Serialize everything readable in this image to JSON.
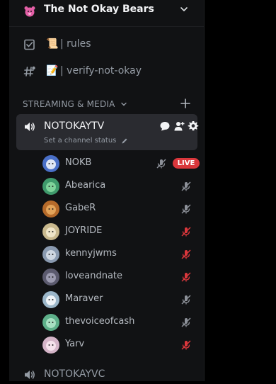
{
  "server": {
    "name": "The Not Okay Bears"
  },
  "text_channels": [
    {
      "emoji": "📜",
      "name": "| rules"
    },
    {
      "emoji": "📝",
      "name": "| verify-not-okay"
    }
  ],
  "category": {
    "label": "STREAMING & MEDIA"
  },
  "active_voice": {
    "name": "NOTOKAYTV",
    "status": "Set a channel status"
  },
  "users": [
    {
      "name": "NOKB",
      "muted": "grey",
      "live": "LIVE",
      "avatar_color": "#4a70c8"
    },
    {
      "name": "Abearica",
      "muted": "grey",
      "avatar_color": "#3f9a6c"
    },
    {
      "name": "GabeR",
      "muted": "grey",
      "avatar_color": "#b56a2a"
    },
    {
      "name": "JOYRIDE",
      "muted": "red",
      "avatar_color": "#c9b98e"
    },
    {
      "name": "kennyjwms",
      "muted": "red",
      "avatar_color": "#8a9ab0"
    },
    {
      "name": "loveandnate",
      "muted": "red",
      "avatar_color": "#5b5a6e"
    },
    {
      "name": "Maraver",
      "muted": "grey",
      "avatar_color": "#9bb6c9"
    },
    {
      "name": "thevoiceofcash",
      "muted": "grey",
      "avatar_color": "#5eb08a"
    },
    {
      "name": "Yarv",
      "muted": "red",
      "avatar_color": "#d4b4c8"
    }
  ],
  "second_voice": {
    "name": "NOTOKAYVC"
  },
  "colors": {
    "muted_red": "#da373c",
    "muted_grey": "#8d9199",
    "live_badge": "#da373c"
  }
}
